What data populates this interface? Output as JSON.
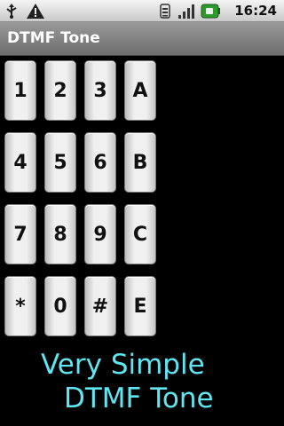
{
  "status_bar": {
    "time": "16:24",
    "icons": [
      "usb-icon",
      "warning-icon",
      "network-activity-icon",
      "signal-icon",
      "battery-icon"
    ]
  },
  "app": {
    "title": "DTMF Tone"
  },
  "keypad": {
    "keys": [
      "1",
      "2",
      "3",
      "A",
      "4",
      "5",
      "6",
      "B",
      "7",
      "8",
      "9",
      "C",
      "*",
      "0",
      "#",
      "E"
    ]
  },
  "caption": {
    "line1": "Very Simple",
    "line2": "DTMF Tone",
    "color": "#5fe6f2"
  },
  "colors": {
    "background": "#000000",
    "key_face": "#f0f0f0"
  }
}
